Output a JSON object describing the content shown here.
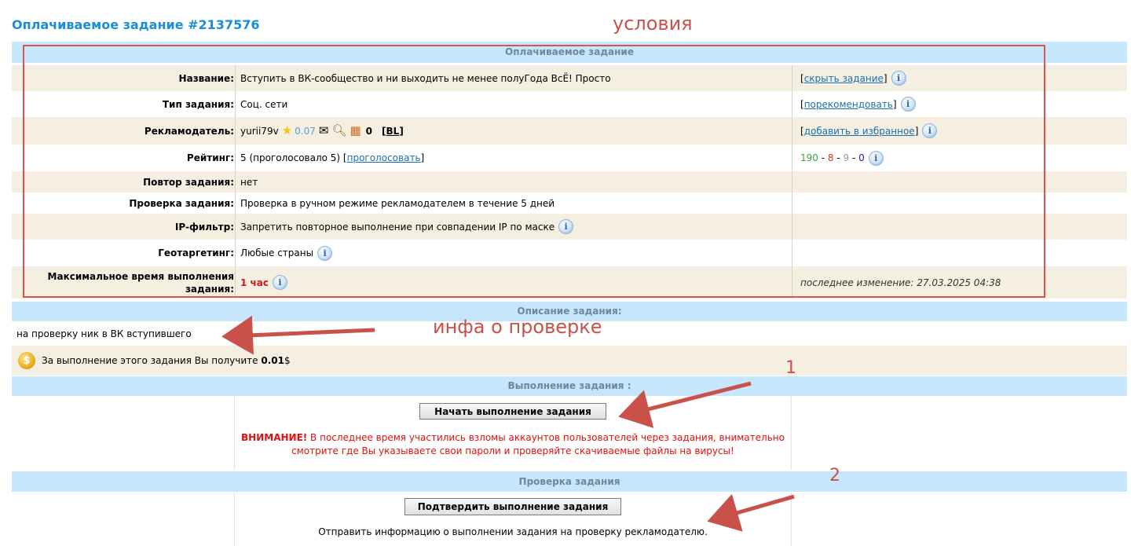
{
  "page": {
    "title": "Оплачиваемое задание #2137576"
  },
  "annotations": {
    "conditions": "условия",
    "check_info": "инфа о проверке",
    "step1": "1",
    "step2": "2"
  },
  "task_section": {
    "header": "Оплачиваемое задание",
    "name": {
      "label": "Название:",
      "value": "Вступить в ВК-сообщество и ни выходить не менее полуГода ВсЁ! Просто",
      "action_prefix": "[",
      "action": "скрыть задание",
      "action_suffix": "]"
    },
    "type": {
      "label": "Тип задания:",
      "value": "Соц. сети",
      "action_prefix": "[",
      "action": "порекомендовать",
      "action_suffix": "]"
    },
    "advertiser": {
      "label": "Рекламодатель:",
      "username": "yurii79v",
      "rating": "0.07",
      "count": "0",
      "bl_prefix": "[",
      "bl": "BL",
      "bl_suffix": "]",
      "action_prefix": "[",
      "action": "добавить в избранное",
      "action_suffix": "]"
    },
    "rating": {
      "label": "Рейтинг:",
      "value": "5 (проголосовало 5) [",
      "vote": "проголосовать",
      "suffix": "]",
      "stat1": "190",
      "sep1": " - ",
      "stat2": "8",
      "sep2": " - ",
      "stat3": "9",
      "sep3": " - ",
      "stat4": "0"
    },
    "repeat": {
      "label": "Повтор задания:",
      "value": "нет"
    },
    "check": {
      "label": "Проверка задания:",
      "value": "Проверка в ручном режиме рекламодателем в течение 5 дней"
    },
    "ip_filter": {
      "label": "IP-фильтр:",
      "value": "Запретить повторное выполнение при совпадении IP по маске"
    },
    "geo": {
      "label": "Геотаргетинг:",
      "value": "Любые страны"
    },
    "max_time": {
      "label_line1": "Максимальное время выполнения",
      "label_line2": "задания:",
      "value": "1 час",
      "last_modified": "последнее изменение: 27.03.2025 04:38"
    }
  },
  "description": {
    "header": "Описание задания:",
    "text": "на проверку ник в ВК вступившего",
    "reward_text": "За выполнение этого задания Вы получите ",
    "reward_value": "0.01",
    "reward_unit": "$"
  },
  "execution": {
    "header": "Выполнение задания :",
    "start_button": "Начать выполнение задания",
    "warning_bold": "ВНИМАНИЕ!",
    "warning_text": " В последнее время участились взломы аккаунтов пользователей через задания, внимательно смотрите где Вы указываете свои пароли и проверяйте скачиваемые файлы на вирусы!"
  },
  "verification": {
    "header": "Проверка задания",
    "confirm_button": "Подтвердить выполнение задания",
    "note": "Отправить информацию о выполнении задания на проверку рекламодателю."
  },
  "icons": {
    "info": "info-icon",
    "star": "star-icon",
    "mail": "mail-icon",
    "search": "magnifier-icon",
    "blacklist": "brick-wall-icon",
    "coin": "coin-icon"
  },
  "colors": {
    "title": "#1a8fd6",
    "header_bg": "#c6e6fb",
    "row_beige": "#f4efe1",
    "annotation": "#c9514a",
    "warning": "#e01010",
    "stat_green": "#3ea33e",
    "stat_red": "#d9341f",
    "stat_grey": "#999999",
    "stat_blue": "#1a1aa6"
  }
}
